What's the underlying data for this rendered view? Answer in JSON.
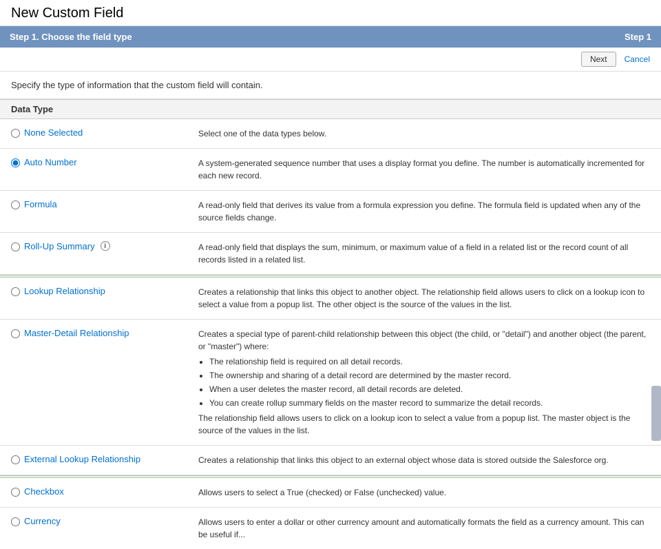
{
  "page": {
    "title": "New Custom Field",
    "step_header": "Step 1. Choose the field type",
    "step_label": "Step 1",
    "description": "Specify the type of information that the custom field will contain.",
    "next_button": "Next",
    "cancel_button": "Cancel",
    "data_type_header": "Data Type"
  },
  "fields": [
    {
      "id": "none-selected",
      "label": "None Selected",
      "description": "Select one of the data types below.",
      "selected": false,
      "has_info": false,
      "section": "basic"
    },
    {
      "id": "auto-number",
      "label": "Auto Number",
      "description": "A system-generated sequence number that uses a display format you define. The number is automatically incremented for each new record.",
      "selected": true,
      "has_info": false,
      "section": "basic"
    },
    {
      "id": "formula",
      "label": "Formula",
      "description": "A read-only field that derives its value from a formula expression you define. The formula field is updated when any of the source fields change.",
      "selected": false,
      "has_info": false,
      "section": "basic"
    },
    {
      "id": "roll-up-summary",
      "label": "Roll-Up Summary",
      "description": "A read-only field that displays the sum, minimum, or maximum value of a field in a related list or the record count of all records listed in a related list.",
      "selected": false,
      "has_info": true,
      "section": "basic"
    },
    {
      "id": "lookup-relationship",
      "label": "Lookup Relationship",
      "description": "Creates a relationship that links this object to another object. The relationship field allows users to click on a lookup icon to select a value from a popup list. The other object is the source of the values in the list.",
      "selected": false,
      "has_info": false,
      "section": "relationship"
    },
    {
      "id": "master-detail-relationship",
      "label": "Master-Detail Relationship",
      "description": "",
      "description_intro": "Creates a special type of parent-child relationship between this object (the child, or \"detail\") and another object (the parent, or \"master\") where:",
      "description_bullets": [
        "The relationship field is required on all detail records.",
        "The ownership and sharing of a detail record are determined by the master record.",
        "When a user deletes the master record, all detail records are deleted.",
        "You can create rollup summary fields on the master record to summarize the detail records."
      ],
      "description_suffix": "The relationship field allows users to click on a lookup icon to select a value from a popup list. The master object is the source of the values in the list.",
      "selected": false,
      "has_info": false,
      "section": "relationship"
    },
    {
      "id": "external-lookup-relationship",
      "label": "External Lookup Relationship",
      "description": "Creates a relationship that links this object to an external object whose data is stored outside the Salesforce org.",
      "selected": false,
      "has_info": false,
      "section": "relationship"
    },
    {
      "id": "checkbox",
      "label": "Checkbox",
      "description": "Allows users to select a True (checked) or False (unchecked) value.",
      "selected": false,
      "has_info": false,
      "section": "basic2"
    },
    {
      "id": "currency",
      "label": "Currency",
      "description": "Allows users to enter a dollar or other currency amount and automatically formats the field as a currency amount. This can be useful if...",
      "selected": false,
      "has_info": false,
      "section": "basic2"
    }
  ]
}
